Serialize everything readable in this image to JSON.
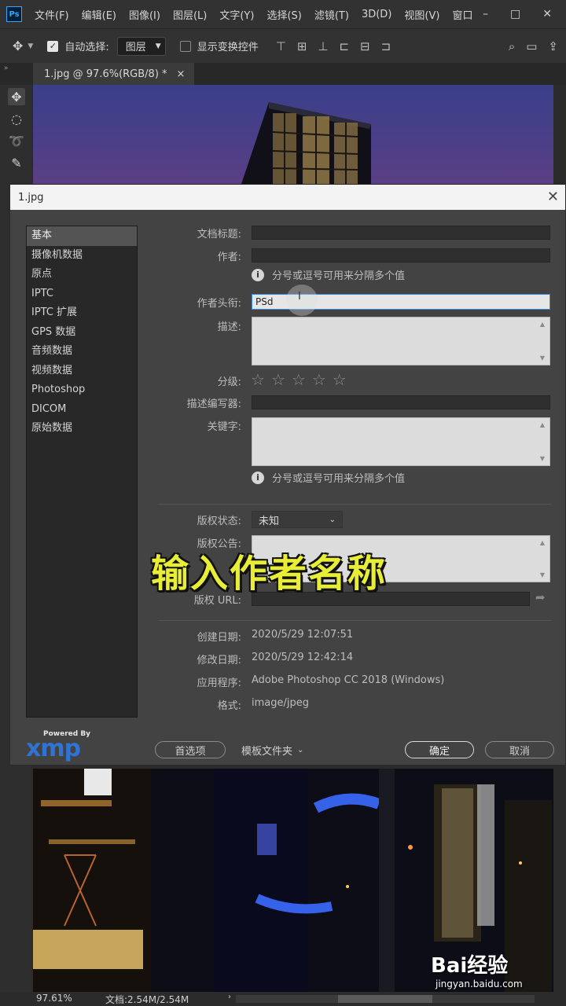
{
  "menubar": {
    "logo": "Ps",
    "items": [
      "文件(F)",
      "编辑(E)",
      "图像(I)",
      "图层(L)",
      "文字(Y)",
      "选择(S)",
      "滤镜(T)",
      "3D(D)",
      "视图(V)",
      "窗口"
    ],
    "window_controls": [
      "–",
      "□",
      "✕"
    ]
  },
  "optionsbar": {
    "move_icon": "move-icon",
    "autoselect_label": "自动选择:",
    "layer_select_value": "图层",
    "transform_label": "显示变换控件"
  },
  "tab": {
    "title": "1.jpg @ 97.6%(RGB/8) *",
    "close": "×"
  },
  "dialog": {
    "title": "1.jpg",
    "close": "✕",
    "categories": [
      "基本",
      "摄像机数据",
      "原点",
      "IPTC",
      "IPTC 扩展",
      "GPS 数据",
      "音频数据",
      "视频数据",
      "Photoshop",
      "DICOM",
      "原始数据"
    ],
    "selected_category": "基本",
    "labels": {
      "doc_title": "文档标题:",
      "author": "作者:",
      "author_title": "作者头衔:",
      "description": "描述:",
      "rating": "分级:",
      "desc_writer": "描述编写器:",
      "keywords": "关键字:",
      "copyright_status": "版权状态:",
      "copyright_notice": "版权公告:",
      "copyright_url": "版权 URL:",
      "created": "创建日期:",
      "modified": "修改日期:",
      "application": "应用程序:",
      "format": "格式:"
    },
    "hint_text": "分号或逗号可用来分隔多个值",
    "author_title_value": "PSd",
    "rating_stars": 5,
    "copyright_status_value": "未知",
    "created_value": "2020/5/29 12:07:51",
    "modified_value": "2020/5/29 12:42:14",
    "application_value": "Adobe Photoshop CC 2018 (Windows)",
    "format_value": "image/jpeg",
    "xmp_powered": "Powered By",
    "xmp_text": "xmp",
    "buttons": {
      "preferences": "首选项",
      "template_folder": "模板文件夹",
      "ok": "确定",
      "cancel": "取消"
    }
  },
  "caption": "输入作者名称",
  "statusbar": {
    "zoom": "97.61%",
    "doc_size": "文档:2.54M/2.54M"
  },
  "watermark": {
    "main": "Bai经验",
    "url": "jingyan.baidu.com"
  }
}
